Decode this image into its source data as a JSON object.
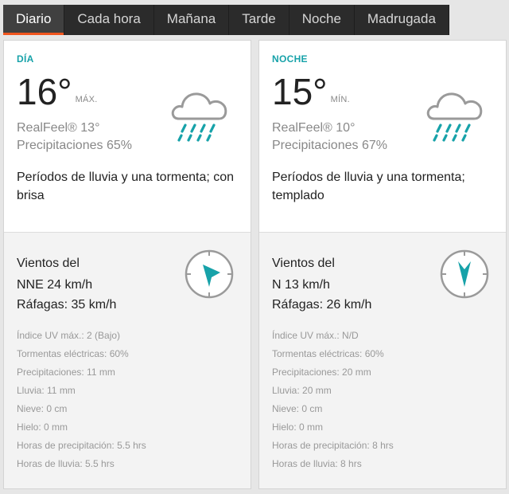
{
  "tabs": [
    {
      "label": "Diario",
      "active": true
    },
    {
      "label": "Cada hora",
      "active": false
    },
    {
      "label": "Mañana",
      "active": false
    },
    {
      "label": "Tarde",
      "active": false
    },
    {
      "label": "Noche",
      "active": false
    },
    {
      "label": "Madrugada",
      "active": false
    }
  ],
  "accent_color": "#17a2a9",
  "tab_highlight_color": "#f0551e",
  "day": {
    "label": "DÍA",
    "temp": "16°",
    "temp_label": "MÁX.",
    "icon": "cloud-rain-icon",
    "realfeel": "RealFeel® 13°",
    "precip": "Precipitaciones 65%",
    "phrase": "Períodos de lluvia y una tormenta; con brisa",
    "wind_title": "Vientos del",
    "wind": "NNE 24 km/h",
    "gusts": "Ráfagas: 35 km/h",
    "compass_icon": "wind-direction-compass-icon",
    "wind_direction": "NNE",
    "details": [
      "Índice UV máx.: 2 (Bajo)",
      "Tormentas eléctricas: 60%",
      "Precipitaciones: 11 mm",
      "Lluvia: 11 mm",
      "Nieve: 0 cm",
      "Hielo: 0 mm",
      "Horas de precipitación: 5.5 hrs",
      "Horas de lluvia: 5.5 hrs"
    ]
  },
  "night": {
    "label": "NOCHE",
    "temp": "15°",
    "temp_label": "MÍN.",
    "icon": "cloud-rain-icon",
    "realfeel": "RealFeel® 10°",
    "precip": "Precipitaciones 67%",
    "phrase": "Períodos de lluvia y una tormenta; templado",
    "wind_title": "Vientos del",
    "wind": "N 13 km/h",
    "gusts": "Ráfagas: 26 km/h",
    "compass_icon": "wind-direction-compass-icon",
    "wind_direction": "N",
    "details": [
      "Índice UV máx.: N/D",
      "Tormentas eléctricas: 60%",
      "Precipitaciones: 20 mm",
      "Lluvia: 20 mm",
      "Nieve: 0 cm",
      "Hielo: 0 mm",
      "Horas de precipitación: 8 hrs",
      "Horas de lluvia: 8 hrs"
    ]
  }
}
